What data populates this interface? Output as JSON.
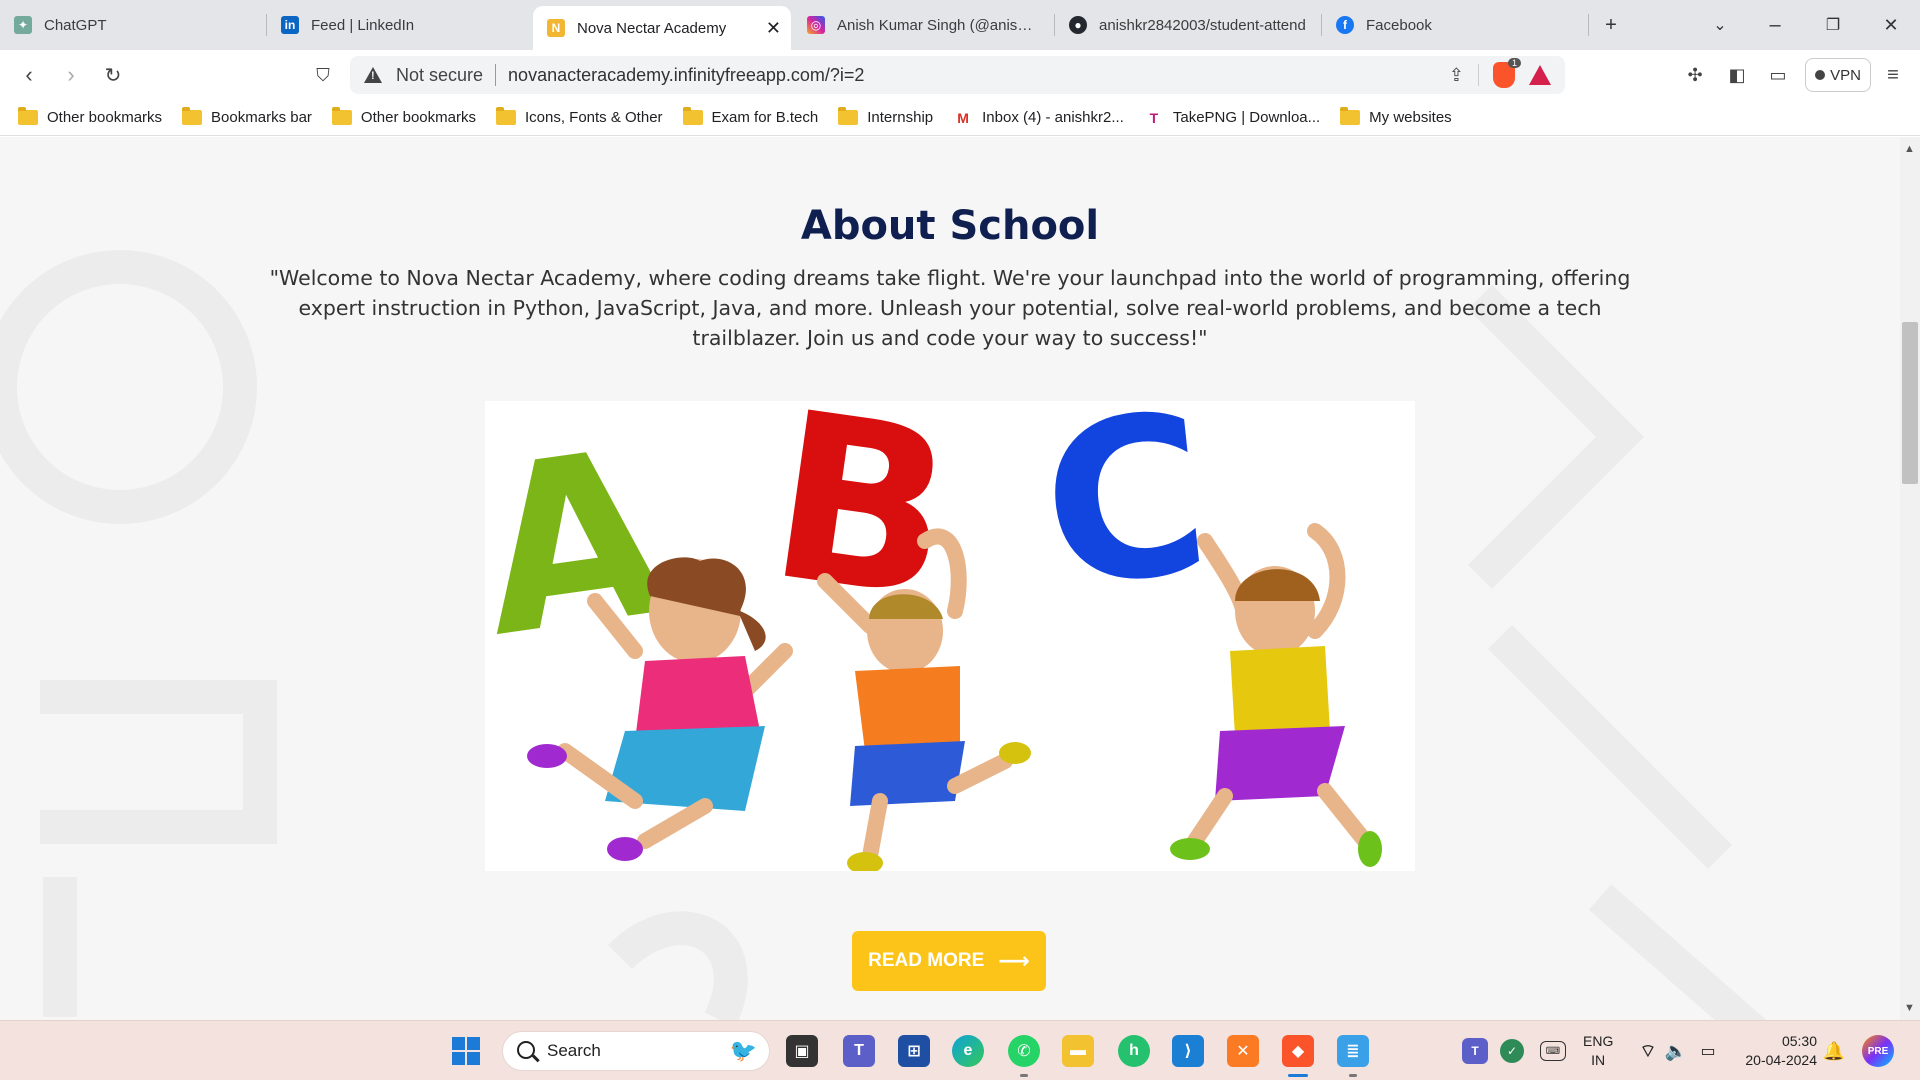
{
  "tabs": [
    {
      "title": "ChatGPT",
      "icon": "chatgpt-icon",
      "color": "#74aa9c"
    },
    {
      "title": "Feed | LinkedIn",
      "icon": "linkedin-icon",
      "color": "#0a66c2"
    },
    {
      "title": "Nova Nectar Academy",
      "icon": "academy-icon",
      "color": "#f2b632",
      "active": true
    },
    {
      "title": "Anish Kumar Singh (@anish_ku",
      "icon": "instagram-icon",
      "color": "#d6249f"
    },
    {
      "title": "anishkr2842003/student-attend",
      "icon": "github-icon",
      "color": "#24292f"
    },
    {
      "title": "Facebook",
      "icon": "facebook-icon",
      "color": "#1877f2"
    }
  ],
  "address_bar": {
    "security_text": "Not secure",
    "url": "novanacteracademy.infinityfreeapp.com/?i=2",
    "brave_shield_count": "1"
  },
  "vpn_label": "VPN",
  "bookmarks": [
    {
      "label": "Other bookmarks",
      "type": "folder"
    },
    {
      "label": "Bookmarks bar",
      "type": "folder"
    },
    {
      "label": "Other bookmarks",
      "type": "folder"
    },
    {
      "label": "Icons, Fonts & Other",
      "type": "folder"
    },
    {
      "label": "Exam for B.tech",
      "type": "folder"
    },
    {
      "label": "Internship",
      "type": "folder"
    },
    {
      "label": "Inbox (4) - anishkr2...",
      "type": "gmail"
    },
    {
      "label": "TakePNG | Downloa...",
      "type": "takepng"
    },
    {
      "label": "My websites",
      "type": "folder"
    }
  ],
  "page": {
    "heading": "About School",
    "paragraph": "\"Welcome to Nova Nectar Academy, where coding dreams take flight. We're your launchpad into the world of programming, offering expert instruction in Python, JavaScript, Java, and more. Unleash your potential, solve real-world problems, and become a tech trailblazer. Join us and code your way to success!\"",
    "illustration_letters": [
      "A",
      "B",
      "C"
    ],
    "read_more_label": "READ MORE",
    "accent_color": "#fcc419",
    "heading_color": "#0f1f4f"
  },
  "taskbar": {
    "search_placeholder": "Search",
    "apps": [
      "file-explorer-dark-icon",
      "teams-icon",
      "store-icon",
      "edge-icon",
      "whatsapp-icon",
      "folder-icon",
      "freshdesk-icon",
      "vscode-icon",
      "xampp-icon",
      "brave-icon",
      "notepad-icon"
    ],
    "language_top": "ENG",
    "language_bottom": "IN",
    "time": "05:30",
    "date": "20-04-2024"
  }
}
